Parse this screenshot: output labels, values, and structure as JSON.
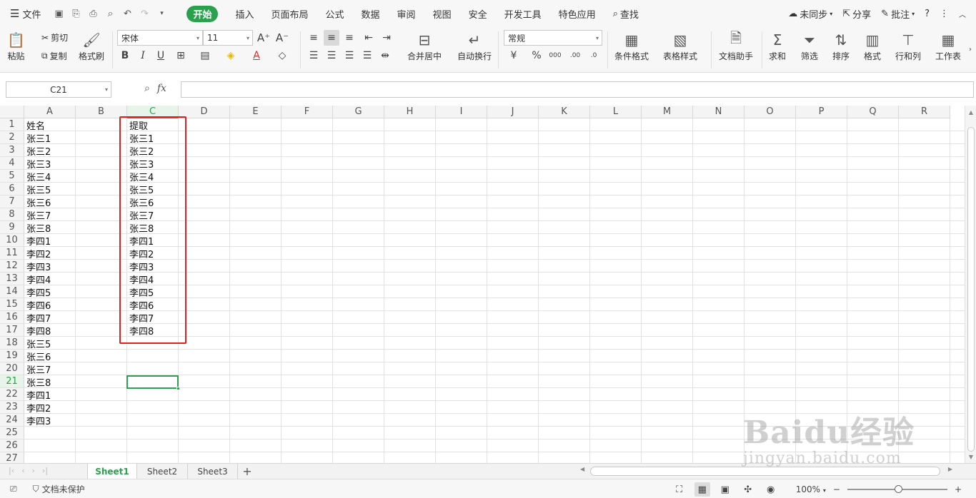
{
  "menubar": {
    "file_label": "文件",
    "tabs": [
      "开始",
      "插入",
      "页面布局",
      "公式",
      "数据",
      "审阅",
      "视图",
      "安全",
      "开发工具",
      "特色应用"
    ],
    "search_label": "查找",
    "sync_label": "未同步",
    "share_label": "分享",
    "comment_label": "批注",
    "help_label": "?"
  },
  "ribbon": {
    "paste": "粘贴",
    "cut": "剪切",
    "copy": "复制",
    "format_painter": "格式刷",
    "font_name": "宋体",
    "font_size": "11",
    "merge_center": "合并居中",
    "wrap_text": "自动换行",
    "number_format": "常规",
    "conditional_format": "条件格式",
    "table_style": "表格样式",
    "doc_assistant": "文档助手",
    "sum": "求和",
    "filter": "筛选",
    "sort": "排序",
    "format": "格式",
    "row_col": "行和列",
    "worksheet": "工作表",
    "bold": "B",
    "italic": "I",
    "underline": "U",
    "percent": "%"
  },
  "formula_bar": {
    "cell_ref": "C21",
    "fx": "fx",
    "value": ""
  },
  "grid": {
    "columns": [
      "A",
      "B",
      "C",
      "D",
      "E",
      "F",
      "G",
      "H",
      "I",
      "J",
      "K",
      "L",
      "M",
      "N",
      "O",
      "P",
      "Q",
      "R"
    ],
    "rows": [
      "1",
      "2",
      "3",
      "4",
      "5",
      "6",
      "7",
      "8",
      "9",
      "10",
      "11",
      "12",
      "13",
      "14",
      "15",
      "16",
      "17",
      "18",
      "19",
      "20",
      "21",
      "22",
      "23",
      "24",
      "25",
      "26",
      "27"
    ],
    "selected_col": "C",
    "selected_row": "21",
    "col_a": [
      "姓名",
      "张三1",
      "张三2",
      "张三3",
      "张三4",
      "张三5",
      "张三6",
      "张三7",
      "张三8",
      "李四1",
      "李四2",
      "李四3",
      "李四4",
      "李四5",
      "李四6",
      "李四7",
      "李四8",
      "张三5",
      "张三6",
      "张三7",
      "张三8",
      "李四1",
      "李四2",
      "李四3"
    ],
    "col_c": [
      "提取",
      "张三1",
      "张三2",
      "张三3",
      "张三4",
      "张三5",
      "张三6",
      "张三7",
      "张三8",
      "李四1",
      "李四2",
      "李四3",
      "李四4",
      "李四5",
      "李四6",
      "李四7",
      "李四8"
    ]
  },
  "sheets": {
    "tabs": [
      "Sheet1",
      "Sheet2",
      "Sheet3"
    ],
    "active": "Sheet1",
    "add": "+"
  },
  "statusbar": {
    "protection": "文档未保护",
    "zoom": "100%",
    "zoom_out": "−",
    "zoom_in": "+"
  },
  "watermark": {
    "line1": "Baidu经验",
    "line2": "jingyan.baidu.com"
  },
  "colors": {
    "accent": "#2aa14c",
    "highlight": "#e02020"
  }
}
